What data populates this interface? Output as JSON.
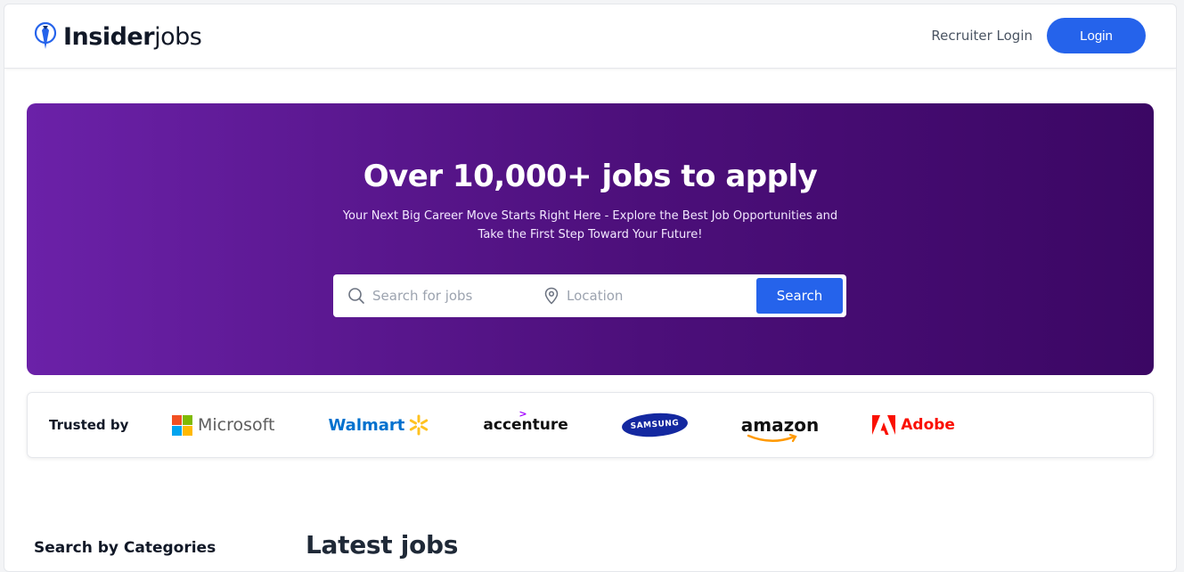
{
  "header": {
    "brand_bold": "Insider",
    "brand_light": "jobs",
    "recruiter_login": "Recruiter Login",
    "login_label": "Login"
  },
  "hero": {
    "title": "Over 10,000+ jobs to apply",
    "subtitle_line1": "Your Next Big Career Move Starts Right Here - Explore the Best Job Opportunities and",
    "subtitle_line2": "Take the First Step Toward Your Future!",
    "search_placeholder": "Search for jobs",
    "location_placeholder": "Location",
    "search_button": "Search"
  },
  "trusted": {
    "label": "Trusted by",
    "companies": {
      "microsoft": "Microsoft",
      "walmart": "Walmart",
      "accenture": "accenture",
      "samsung": "SAMSUNG",
      "amazon": "amazon",
      "adobe": "Adobe"
    }
  },
  "sections": {
    "categories_heading": "Search by Categories",
    "latest_heading": "Latest jobs"
  },
  "colors": {
    "accent": "#2563eb",
    "hero_start": "#6b21a8",
    "hero_end": "#3b0764"
  },
  "icons": {
    "brand": "tie-pin-icon",
    "search": "search-icon",
    "location": "location-pin-icon"
  }
}
